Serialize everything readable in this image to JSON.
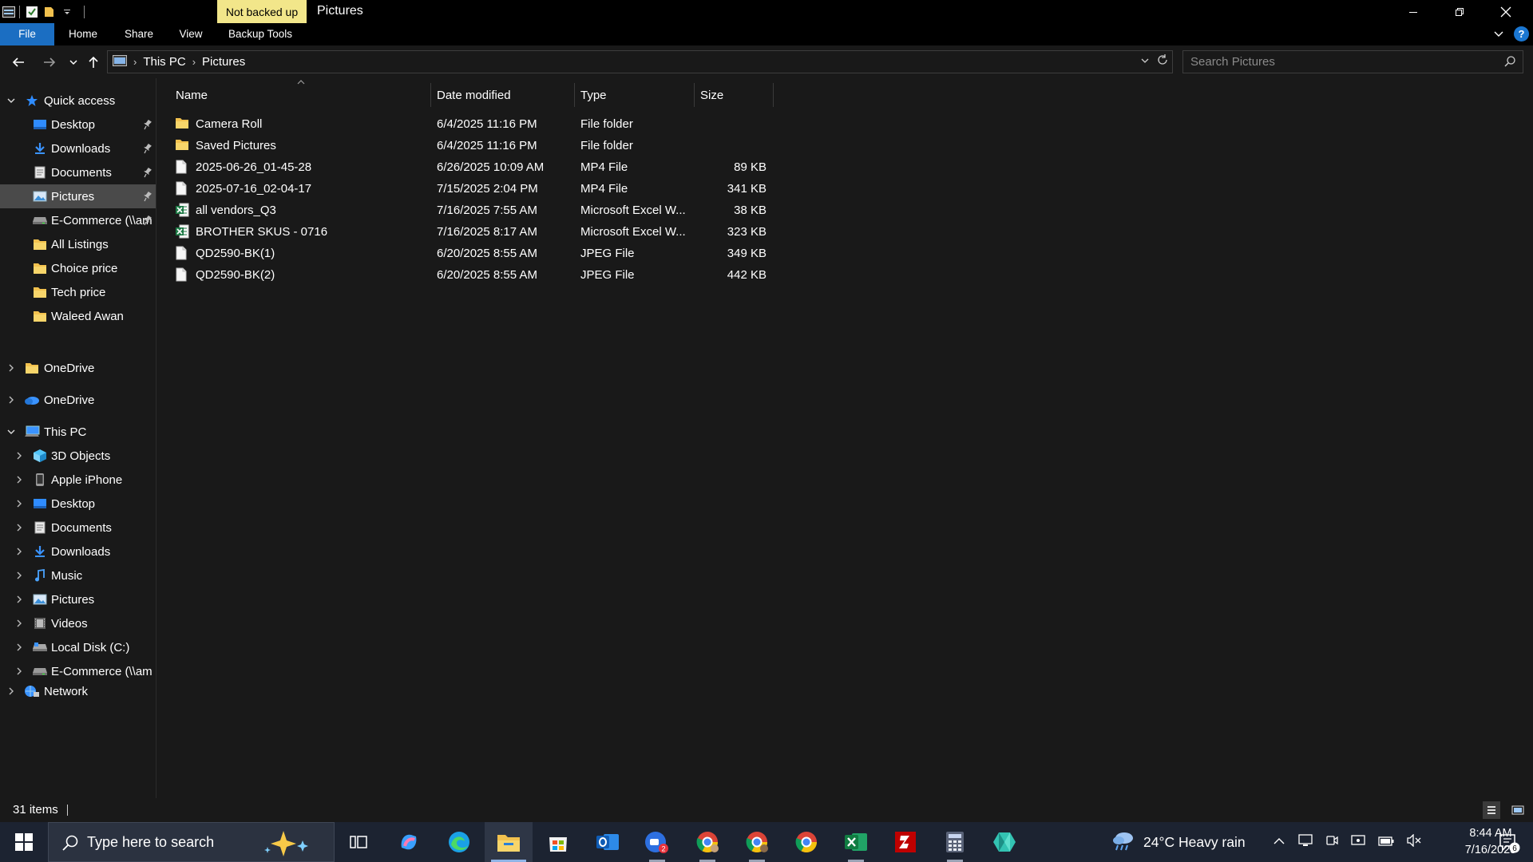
{
  "window": {
    "title": "Pictures",
    "context_tab": "Not backed up"
  },
  "ribbon": {
    "tabs": [
      "File",
      "Home",
      "Share",
      "View",
      "Backup Tools"
    ]
  },
  "address": {
    "crumbs": [
      "This PC",
      "Pictures"
    ]
  },
  "search": {
    "placeholder": "Search Pictures"
  },
  "nav": {
    "quick_access": "Quick access",
    "quick_items": [
      {
        "label": "Desktop",
        "icon": "desktop-icon",
        "pinned": true
      },
      {
        "label": "Downloads",
        "icon": "downloads-icon",
        "pinned": true
      },
      {
        "label": "Documents",
        "icon": "documents-icon",
        "pinned": true
      },
      {
        "label": "Pictures",
        "icon": "pictures-icon",
        "pinned": true,
        "selected": true
      },
      {
        "label": "E-Commerce (\\\\am",
        "icon": "network-drive-icon",
        "pinned": true
      },
      {
        "label": "All Listings",
        "icon": "folder-icon"
      },
      {
        "label": "Choice price",
        "icon": "folder-icon"
      },
      {
        "label": "Tech price",
        "icon": "folder-icon"
      },
      {
        "label": "Waleed Awan",
        "icon": "folder-icon"
      }
    ],
    "onedrive_1": "OneDrive",
    "onedrive_2": "OneDrive",
    "this_pc": "This PC",
    "pc_items": [
      {
        "label": "3D Objects",
        "icon": "3d-objects-icon"
      },
      {
        "label": "Apple iPhone",
        "icon": "phone-icon"
      },
      {
        "label": "Desktop",
        "icon": "desktop-icon"
      },
      {
        "label": "Documents",
        "icon": "documents-icon"
      },
      {
        "label": "Downloads",
        "icon": "downloads-icon"
      },
      {
        "label": "Music",
        "icon": "music-icon"
      },
      {
        "label": "Pictures",
        "icon": "pictures-icon"
      },
      {
        "label": "Videos",
        "icon": "videos-icon"
      },
      {
        "label": "Local Disk (C:)",
        "icon": "local-disk-icon"
      },
      {
        "label": "E-Commerce (\\\\am",
        "icon": "network-drive-icon"
      }
    ],
    "network": "Network"
  },
  "columns": {
    "name": "Name",
    "date": "Date modified",
    "type": "Type",
    "size": "Size"
  },
  "files": [
    {
      "name": "Camera Roll",
      "date": "6/4/2025 11:16 PM",
      "type": "File folder",
      "size": "",
      "icon": "folder-icon"
    },
    {
      "name": "Saved Pictures",
      "date": "6/4/2025 11:16 PM",
      "type": "File folder",
      "size": "",
      "icon": "folder-icon"
    },
    {
      "name": "2025-06-26_01-45-28",
      "date": "6/26/2025 10:09 AM",
      "type": "MP4 File",
      "size": "89 KB",
      "icon": "file-icon"
    },
    {
      "name": "2025-07-16_02-04-17",
      "date": "7/15/2025 2:04 PM",
      "type": "MP4 File",
      "size": "341 KB",
      "icon": "file-icon"
    },
    {
      "name": "all vendors_Q3",
      "date": "7/16/2025 7:55 AM",
      "type": "Microsoft Excel W...",
      "size": "38 KB",
      "icon": "excel-file-icon"
    },
    {
      "name": "BROTHER SKUS - 0716",
      "date": "7/16/2025 8:17 AM",
      "type": "Microsoft Excel W...",
      "size": "323 KB",
      "icon": "excel-file-icon"
    },
    {
      "name": "QD2590-BK(1)",
      "date": "6/20/2025 8:55 AM",
      "type": "JPEG File",
      "size": "349 KB",
      "icon": "file-icon"
    },
    {
      "name": "QD2590-BK(2)",
      "date": "6/20/2025 8:55 AM",
      "type": "JPEG File",
      "size": "442 KB",
      "icon": "file-icon"
    }
  ],
  "status": {
    "item_count": "31 items"
  },
  "taskbar": {
    "search_placeholder": "Type here to search",
    "zoom_badge": "2",
    "weather": "24°C  Heavy rain",
    "time": "8:44 AM",
    "date": "7/16/2025",
    "notification_count": "6"
  },
  "colors": {
    "accent": "#1b6ec2",
    "context_tab": "#f2e68a",
    "folder": "#f2c14e",
    "excel": "#1d7a45"
  }
}
